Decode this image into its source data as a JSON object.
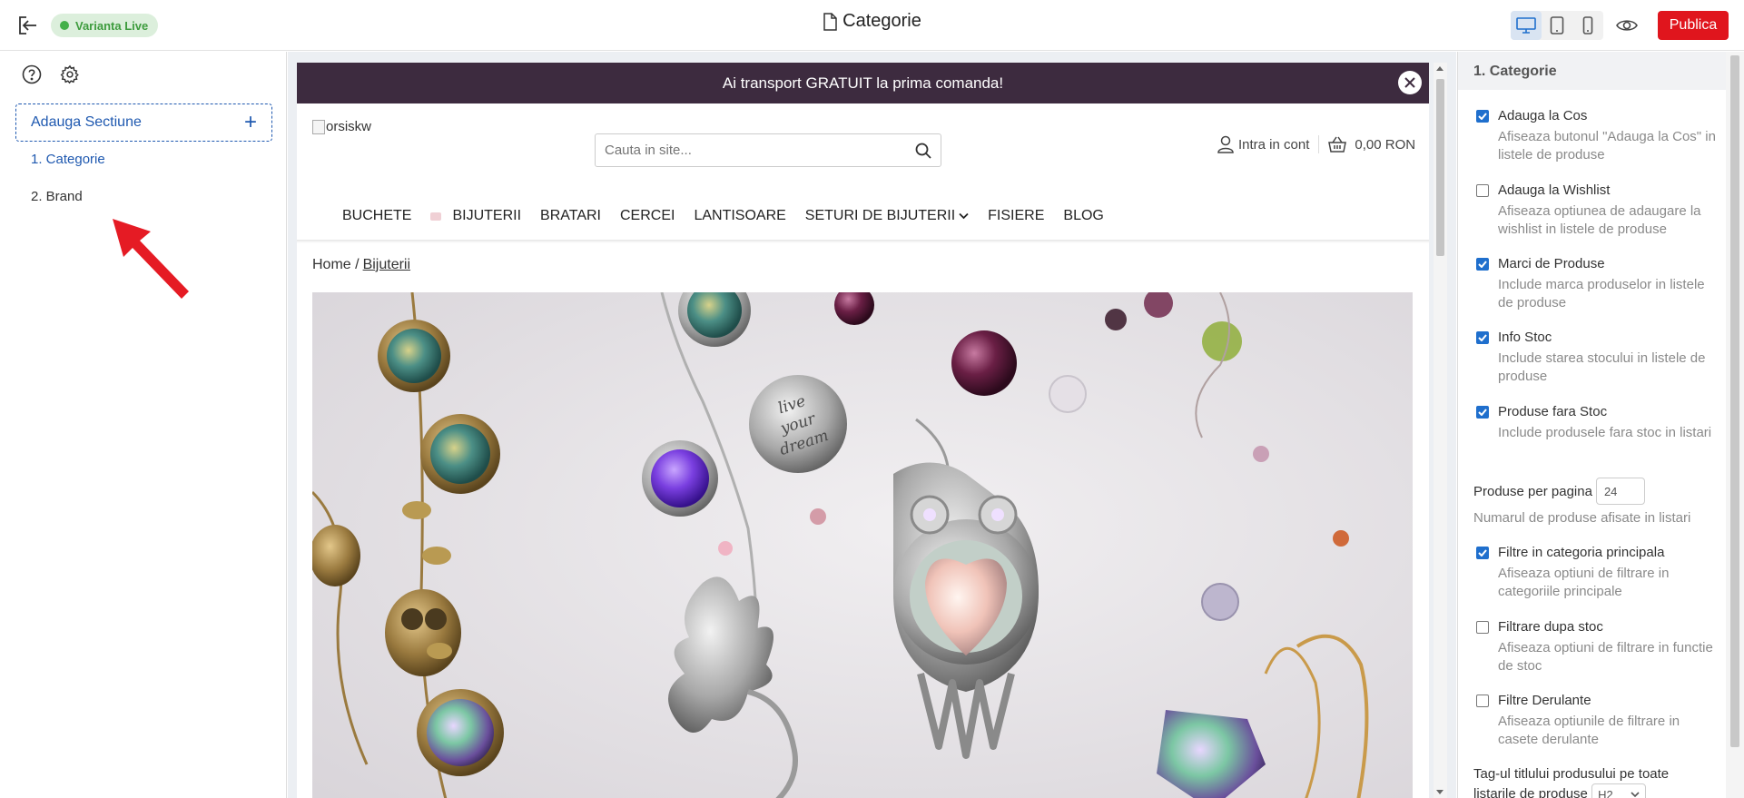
{
  "topbar": {
    "live_badge": "Varianta Live",
    "page_title": "Categorie",
    "publish_label": "Publica",
    "colors": {
      "publish": "#e0151d",
      "live_dot": "#43b049",
      "accent": "#1f59b0"
    },
    "device_modes": [
      "desktop-icon",
      "tablet-icon",
      "mobile-icon"
    ],
    "active_device": "desktop"
  },
  "sidebar": {
    "add_section_label": "Adauga Sectiune",
    "sections": [
      {
        "label": "1. Categorie",
        "active": true
      },
      {
        "label": "2. Brand",
        "active": false
      }
    ]
  },
  "preview": {
    "promo_text": "Ai transport GRATUIT la prima comanda!",
    "logo_alt": "orsiskw",
    "search_placeholder": "Cauta in site...",
    "account_label": "Intra in cont",
    "cart_amount": "0,00 RON",
    "nav": [
      "BUCHETE",
      "BIJUTERII",
      "BRATARI",
      "CERCEI",
      "LANTISOARE",
      "SETURI DE BIJUTERII",
      "FISIERE",
      "BLOG"
    ],
    "breadcrumb": {
      "home": "Home /",
      "current": "Bijuterii"
    },
    "hero_pendant_text": [
      "live",
      "your",
      "dream"
    ]
  },
  "settings": {
    "title": "1. Categorie",
    "options": [
      {
        "label": "Adauga la Cos",
        "checked": true,
        "desc": "Afiseaza butonul \"Adauga la Cos\" in listele de produse"
      },
      {
        "label": "Adauga la Wishlist",
        "checked": false,
        "desc": "Afiseaza optiunea de adaugare la wishlist in listele de produse"
      },
      {
        "label": "Marci de Produse",
        "checked": true,
        "desc": "Include marca produselor in listele de produse"
      },
      {
        "label": "Info Stoc",
        "checked": true,
        "desc": "Include starea stocului in listele de produse"
      },
      {
        "label": "Produse fara Stoc",
        "checked": true,
        "desc": "Include produsele fara stoc in listari"
      },
      {
        "label": "Filtre in categoria principala",
        "checked": true,
        "desc": "Afiseaza optiuni de filtrare in categoriile principale"
      },
      {
        "label": "Filtrare dupa stoc",
        "checked": false,
        "desc": "Afiseaza optiuni de filtrare in functie de stoc"
      },
      {
        "label": "Filtre Derulante",
        "checked": false,
        "desc": "Afiseaza optiunile de filtrare in casete derulante"
      }
    ],
    "per_page_label": "Produse per pagina",
    "per_page_value": "24",
    "per_page_desc": "Numarul de produse afisate in listari",
    "tag_label": "Tag-ul titlului produsului pe toate listarile de produse",
    "tag_value": "H2"
  }
}
